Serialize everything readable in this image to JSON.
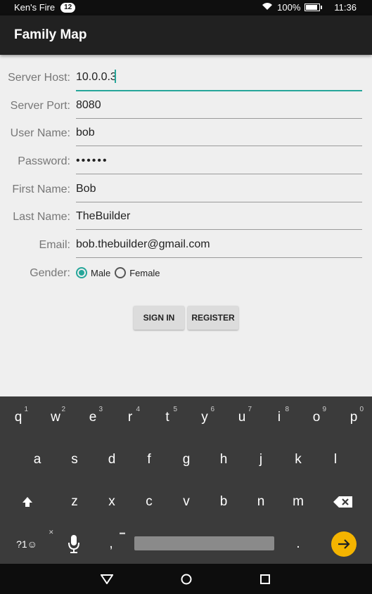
{
  "status_bar": {
    "owner": "Ken's Fire",
    "notification_count": "12",
    "battery": "100%",
    "time": "11:36",
    "battery_level": 1.0
  },
  "app": {
    "title": "Family Map"
  },
  "form": {
    "server_host": {
      "label": "Server Host:",
      "value": "10.0.0.3"
    },
    "server_port": {
      "label": "Server Port:",
      "value": "8080"
    },
    "user_name": {
      "label": "User Name:",
      "value": "bob"
    },
    "password": {
      "label": "Password:",
      "value": "••••••"
    },
    "first_name": {
      "label": "First Name:",
      "value": "Bob"
    },
    "last_name": {
      "label": "Last Name:",
      "value": "TheBuilder"
    },
    "email": {
      "label": "Email:",
      "value": "bob.thebuilder@gmail.com"
    },
    "gender": {
      "label": "Gender:",
      "options": [
        "Male",
        "Female"
      ],
      "selected": "Male"
    }
  },
  "buttons": {
    "sign_in": "SIGN IN",
    "register": "REGISTER"
  },
  "keyboard": {
    "row1": [
      {
        "key": "q",
        "hint": "1"
      },
      {
        "key": "w",
        "hint": "2"
      },
      {
        "key": "e",
        "hint": "3"
      },
      {
        "key": "r",
        "hint": "4"
      },
      {
        "key": "t",
        "hint": "5"
      },
      {
        "key": "y",
        "hint": "6"
      },
      {
        "key": "u",
        "hint": "7"
      },
      {
        "key": "i",
        "hint": "8"
      },
      {
        "key": "o",
        "hint": "9"
      },
      {
        "key": "p",
        "hint": "0"
      }
    ],
    "row2": [
      "a",
      "s",
      "d",
      "f",
      "g",
      "h",
      "j",
      "k",
      "l"
    ],
    "row3": [
      "z",
      "x",
      "c",
      "v",
      "b",
      "n",
      "m"
    ],
    "symbols_key": "?1☺",
    "comma": ",",
    "period": ".",
    "enter_color": "#f4b400"
  },
  "colors": {
    "accent": "#26a69a",
    "app_bar": "#212121",
    "background": "#efefef"
  }
}
